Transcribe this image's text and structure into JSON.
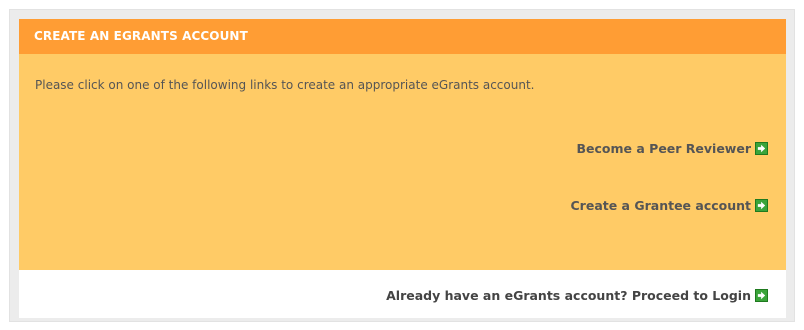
{
  "panel": {
    "title": "CREATE AN EGRANTS ACCOUNT",
    "intro": "Please click on one of the following links to create an appropriate eGrants account.",
    "links": [
      {
        "label": "Become a Peer Reviewer",
        "icon": "arrow-right-icon"
      },
      {
        "label": "Create a Grantee account",
        "icon": "arrow-right-icon"
      }
    ],
    "footer_link": {
      "label": "Already have an eGrants account? Proceed to Login",
      "icon": "arrow-right-icon"
    }
  },
  "colors": {
    "header": "#ff9d34",
    "body": "#ffcb66",
    "icon": "#3aa43a"
  }
}
